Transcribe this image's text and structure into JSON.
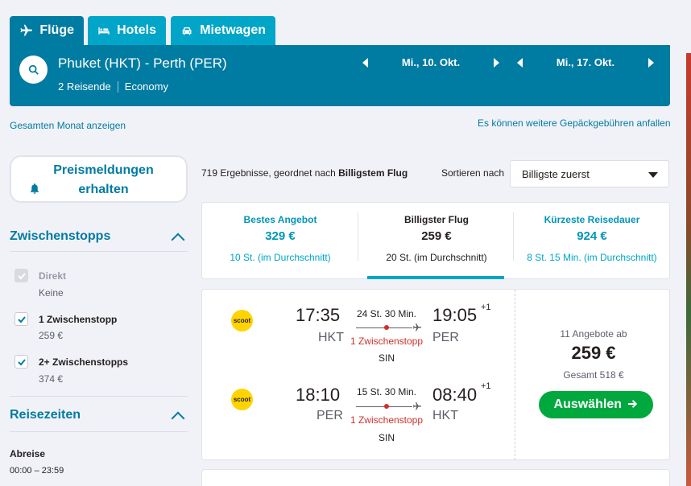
{
  "tabs": [
    {
      "label": "Flüge",
      "icon": "plane-icon",
      "active": true
    },
    {
      "label": "Hotels",
      "icon": "bed-icon",
      "active": false
    },
    {
      "label": "Mietwagen",
      "icon": "car-icon",
      "active": false
    }
  ],
  "search": {
    "route": "Phuket (HKT) - Perth (PER)",
    "travellers": "2 Reisende",
    "cabin": "Economy",
    "depart_date": "Mi., 10. Okt.",
    "return_date": "Mi., 17. Okt."
  },
  "links": {
    "whole_month": "Gesamten Monat anzeigen",
    "baggage_fees": "Es können weitere Gepäckgebühren anfallen"
  },
  "sidebar": {
    "alert_button": "Preismeldungen erhalten",
    "stops_title": "Zwischenstopps",
    "stops": [
      {
        "label": "Direkt",
        "price": "Keine",
        "checked": true,
        "disabled": true
      },
      {
        "label": "1 Zwischenstopp",
        "price": "259 €",
        "checked": true,
        "disabled": false
      },
      {
        "label": "2+ Zwischenstopps",
        "price": "374 €",
        "checked": true,
        "disabled": false
      }
    ],
    "times_title": "Reisezeiten",
    "departure_label": "Abreise",
    "departure_range": "00:00 – 23:59"
  },
  "results": {
    "count_text": "719 Ergebnisse, geordnet nach",
    "count_sort": "Billigstem Flug",
    "sort_label": "Sortieren nach",
    "sort_value": "Billigste zuerst"
  },
  "sort_tabs": [
    {
      "title": "Bestes Angebot",
      "price": "329 €",
      "duration": "10 St. (im Durchschnitt)"
    },
    {
      "title": "Billigster Flug",
      "price": "259 €",
      "duration": "20 St. (im Durchschnitt)"
    },
    {
      "title": "Kürzeste Reisedauer",
      "price": "924 €",
      "duration": "8 St. 15 Min. (im Durchschnitt)"
    }
  ],
  "result_card": {
    "legs": [
      {
        "airline": "scoot",
        "dep_time": "17:35",
        "dep_code": "HKT",
        "duration": "24 St. 30 Min.",
        "stops": "1 Zwischenstopp",
        "via": "SIN",
        "arr_time": "19:05",
        "arr_plus": "+1",
        "arr_code": "PER"
      },
      {
        "airline": "scoot",
        "dep_time": "18:10",
        "dep_code": "PER",
        "duration": "15 St. 30 Min.",
        "stops": "1 Zwischenstopp",
        "via": "SIN",
        "arr_time": "08:40",
        "arr_plus": "+1",
        "arr_code": "HKT"
      }
    ],
    "offers": "11 Angebote ab",
    "price": "259 €",
    "total": "Gesamt 518 €",
    "select_label": "Auswählen"
  },
  "colors": {
    "primary": "#007ba1",
    "accent": "#00a5c8",
    "cta": "#00a83e",
    "stop_red": "#d0302a"
  }
}
